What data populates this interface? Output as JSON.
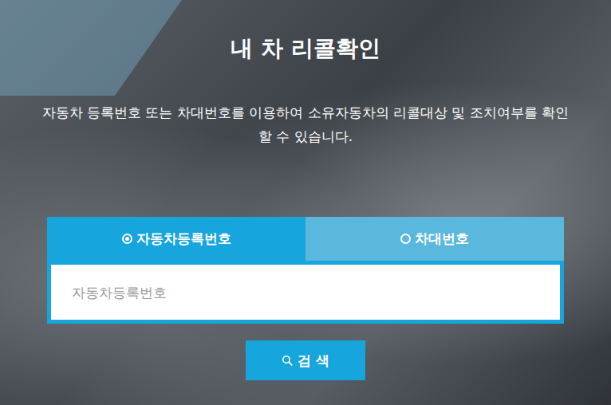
{
  "page": {
    "title": "내 차 리콜확인",
    "description": "자동차 등록번호 또는 차대번호를 이용하여 소유자동차의 리콜대상 및 조치여부를 확인할 수 있습니다."
  },
  "tabs": [
    {
      "label": "자동차등록번호",
      "selected": true
    },
    {
      "label": "차대번호",
      "selected": false
    }
  ],
  "search": {
    "placeholder": "자동차등록번호",
    "button": "검 색"
  }
}
